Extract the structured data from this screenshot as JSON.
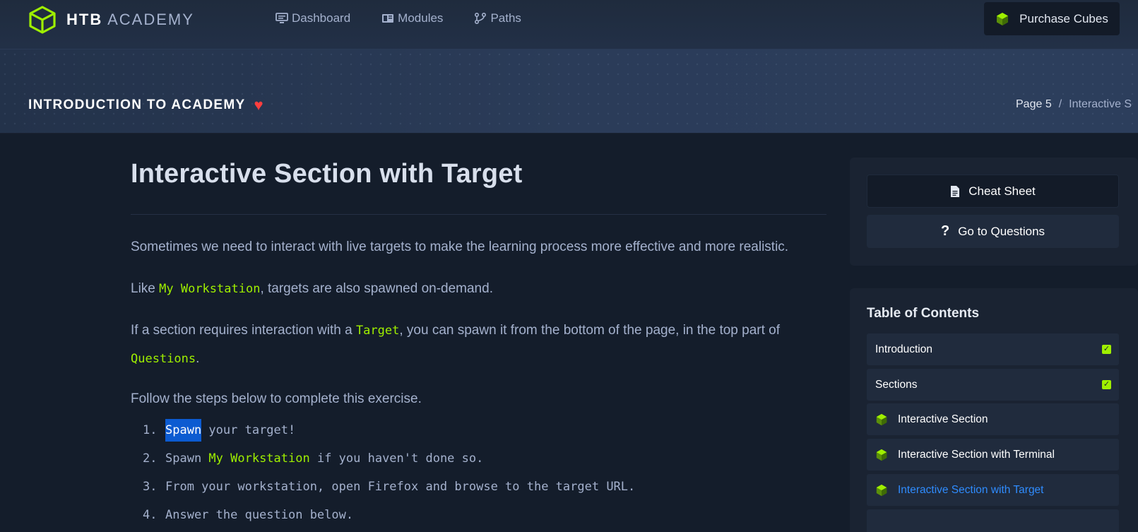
{
  "brand": {
    "bold": "HTB",
    "light": "ACADEMY"
  },
  "nav": [
    {
      "label": "Dashboard",
      "icon": "monitor-icon"
    },
    {
      "label": "Modules",
      "icon": "book-icon"
    },
    {
      "label": "Paths",
      "icon": "paths-icon"
    }
  ],
  "purchase": {
    "label": "Purchase Cubes",
    "icon": "cube-icon"
  },
  "course": {
    "title": "INTRODUCTION TO ACADEMY",
    "favorite_icon": "heart-icon"
  },
  "breadcrumb": {
    "page": "Page 5",
    "separator": "/",
    "current": "Interactive S"
  },
  "content": {
    "title": "Interactive Section with Target",
    "p1": "Sometimes we need to interact with live targets to make the learning process more effective and more realistic.",
    "p2_pre": "Like ",
    "p2_code": "My Workstation",
    "p2_post": ", targets are also spawned on-demand.",
    "p3_pre": "If a section requires interaction with a ",
    "p3_code1": "Target",
    "p3_mid": ", you can spawn it from the bottom of the page, in the top part of ",
    "p3_code2": "Questions",
    "p3_post": ".",
    "p4": "Follow the steps below to complete this exercise.",
    "steps": [
      {
        "num": "1.",
        "highlight": "Spawn",
        "text": " your target!"
      },
      {
        "num": "2.",
        "pre": "Spawn ",
        "code": "My Workstation",
        "text": " if you haven't done so."
      },
      {
        "num": "3.",
        "text": "From your workstation, open Firefox and browse to the target URL."
      },
      {
        "num": "4.",
        "text": "Answer the question below."
      }
    ]
  },
  "sidebar": {
    "cheat_sheet": "Cheat Sheet",
    "go_to_questions": "Go to Questions",
    "toc_title": "Table of Contents",
    "toc": [
      {
        "label": "Introduction",
        "done": true
      },
      {
        "label": "Sections",
        "done": true
      },
      {
        "label": "Interactive Section"
      },
      {
        "label": "Interactive Section with Terminal"
      },
      {
        "label": "Interactive Section with Target",
        "active": true
      }
    ]
  },
  "colors": {
    "accent": "#9fef00",
    "link": "#2f8cff",
    "heart": "#ff3e3e",
    "selection": "#0c5bd1"
  }
}
